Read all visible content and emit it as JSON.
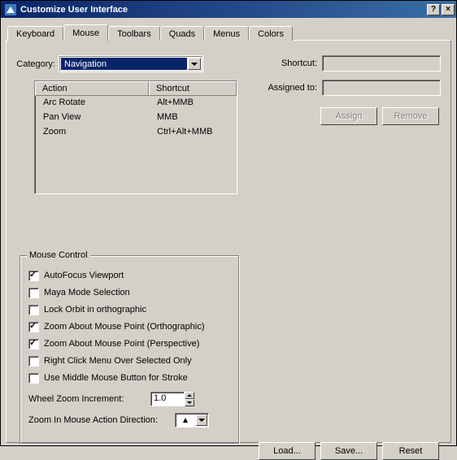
{
  "window": {
    "title": "Customize User Interface",
    "help": "?",
    "close": "×"
  },
  "tabs": [
    "Keyboard",
    "Mouse",
    "Toolbars",
    "Quads",
    "Menus",
    "Colors"
  ],
  "active_tab": 1,
  "category": {
    "label": "Category:",
    "selected": "Navigation"
  },
  "shortcut_panel": {
    "shortcut_label": "Shortcut:",
    "assigned_label": "Assigned to:",
    "shortcut_value": "",
    "assigned_value": "",
    "assign_btn": "Assign",
    "remove_btn": "Remove"
  },
  "action_table": {
    "headers": [
      "Action",
      "Shortcut"
    ],
    "rows": [
      {
        "action": "Arc Rotate",
        "shortcut": "Alt+MMB"
      },
      {
        "action": "Pan View",
        "shortcut": "MMB"
      },
      {
        "action": "Zoom",
        "shortcut": "Ctrl+Alt+MMB"
      }
    ]
  },
  "mouse_control": {
    "legend": "Mouse Control",
    "checks": [
      {
        "label": "AutoFocus Viewport",
        "checked": true
      },
      {
        "label": "Maya Mode Selection",
        "checked": false
      },
      {
        "label": "Lock Orbit in orthographic",
        "checked": false
      },
      {
        "label": "Zoom About Mouse Point (Orthographic)",
        "checked": true
      },
      {
        "label": "Zoom About Mouse Point (Perspective)",
        "checked": true
      },
      {
        "label": "Right Click Menu Over Selected Only",
        "checked": false
      },
      {
        "label": "Use Middle Mouse Button for Stroke",
        "checked": false
      }
    ],
    "wheel_label": "Wheel Zoom Increment:",
    "wheel_value": "1.0",
    "dir_label": "Zoom In Mouse Action Direction:"
  },
  "bottom": {
    "load": "Load...",
    "save": "Save...",
    "reset": "Reset"
  }
}
